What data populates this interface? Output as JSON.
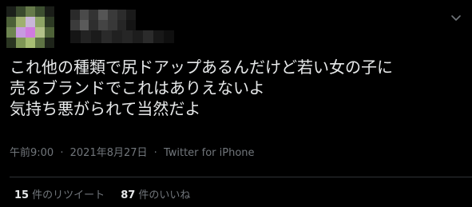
{
  "tweet": {
    "body_lines": [
      "これ他の種類で尻ドアップあるんだけど若い女の子に",
      "売るブランドでこれはありえないよ",
      "気持ち悪がられて当然だよ"
    ],
    "time": "午前9:00",
    "separator": "·",
    "date": "2021年8月27日",
    "source": "Twitter for iPhone",
    "retweets_count": "15",
    "retweets_label": "件のリツイート",
    "likes_count": "87",
    "likes_label": "件のいいね"
  },
  "icons": {
    "avatar": "blurred-avatar",
    "more": "chevron-down-icon"
  },
  "colors": {
    "background": "#000000",
    "text": "#e7e9ea",
    "secondary": "#71767b",
    "divider": "#2f3336"
  }
}
